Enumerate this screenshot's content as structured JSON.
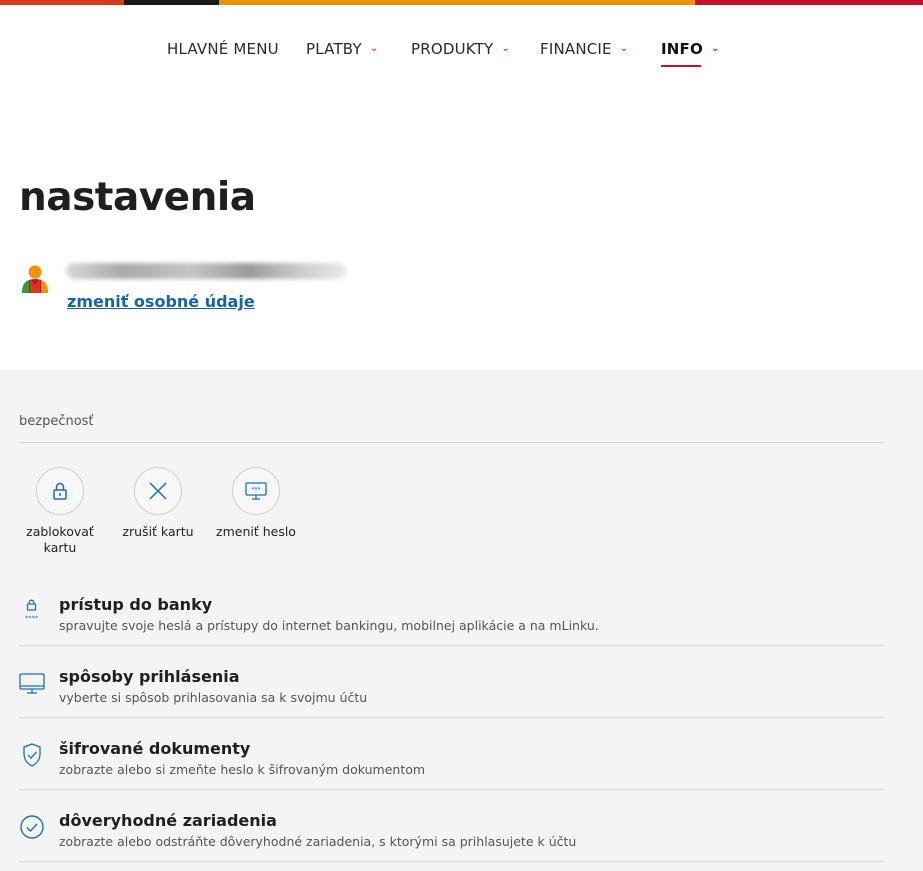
{
  "colors": {
    "stripe": [
      "#d9381e",
      "#1a1a1a",
      "#f39200",
      "#c8102e"
    ],
    "accent": "#c8102e",
    "link": "#1565a6",
    "icon": "#1e6fb5"
  },
  "nav": {
    "items": [
      {
        "label": "HLAVNÉ MENU",
        "has_dropdown": false
      },
      {
        "label": "PLATBY",
        "has_dropdown": true
      },
      {
        "label": "PRODUKTY",
        "has_dropdown": true
      },
      {
        "label": "FINANCIE",
        "has_dropdown": true
      },
      {
        "label": "INFO",
        "has_dropdown": true,
        "active": true
      }
    ]
  },
  "page": {
    "title": "nastavenia"
  },
  "profile": {
    "avatar_icon": "user-avatar-icon",
    "edit_link": "zmeniť osobné údaje"
  },
  "security": {
    "section_label": "bezpečnosť",
    "quick_actions": [
      {
        "label": "zablokovať kartu",
        "icon": "lock-icon"
      },
      {
        "label": "zrušiť kartu",
        "icon": "close-icon"
      },
      {
        "label": "zmeniť heslo",
        "icon": "password-screen-icon"
      }
    ],
    "rows": [
      {
        "title": "prístup do banky",
        "desc": "spravujte svoje heslá a prístupy do internet bankingu, mobilnej aplikácie a na mLinku.",
        "icon": "lock-password-icon"
      },
      {
        "title": "spôsoby prihlásenia",
        "desc": "vyberte si spôsob prihlasovania sa k svojmu účtu",
        "icon": "monitor-icon"
      },
      {
        "title": "šifrované dokumenty",
        "desc": "zobrazte alebo si zmeňte heslo k šifrovaným dokumentom",
        "icon": "shield-check-icon"
      },
      {
        "title": "dôveryhodné zariadenia",
        "desc": "zobrazte alebo odstráňte dôveryhodné zariadenia, s ktorými sa prihlasujete k účtu",
        "icon": "check-circle-icon"
      }
    ]
  }
}
